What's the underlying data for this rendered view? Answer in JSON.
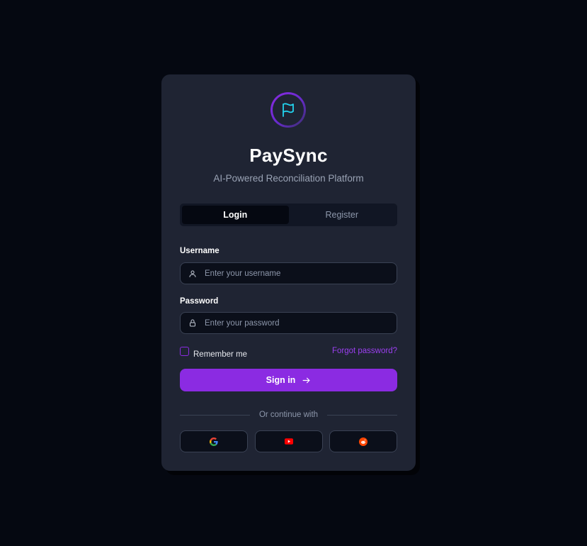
{
  "app": {
    "title": "PaySync",
    "subtitle": "AI-Powered Reconciliation Platform",
    "logo_icon": "flag-icon"
  },
  "tabs": [
    {
      "label": "Login",
      "active": true
    },
    {
      "label": "Register",
      "active": false
    }
  ],
  "form": {
    "username": {
      "label": "Username",
      "placeholder": "Enter your username",
      "value": "",
      "icon": "user-icon"
    },
    "password": {
      "label": "Password",
      "placeholder": "Enter your password",
      "value": "",
      "icon": "lock-icon"
    },
    "remember_label": "Remember me",
    "remember_checked": false,
    "forgot_label": "Forgot password?",
    "submit_label": "Sign in"
  },
  "social": {
    "divider_text": "Or continue with",
    "providers": [
      {
        "name": "Google",
        "icon": "google-icon"
      },
      {
        "name": "YouTube",
        "icon": "youtube-icon"
      },
      {
        "name": "Reddit",
        "icon": "reddit-icon"
      }
    ]
  },
  "colors": {
    "background": "#050811",
    "card": "#1f2433",
    "accent": "#8b2be2",
    "logo_stroke": "#22d3ee",
    "link": "#9b3ff0"
  }
}
